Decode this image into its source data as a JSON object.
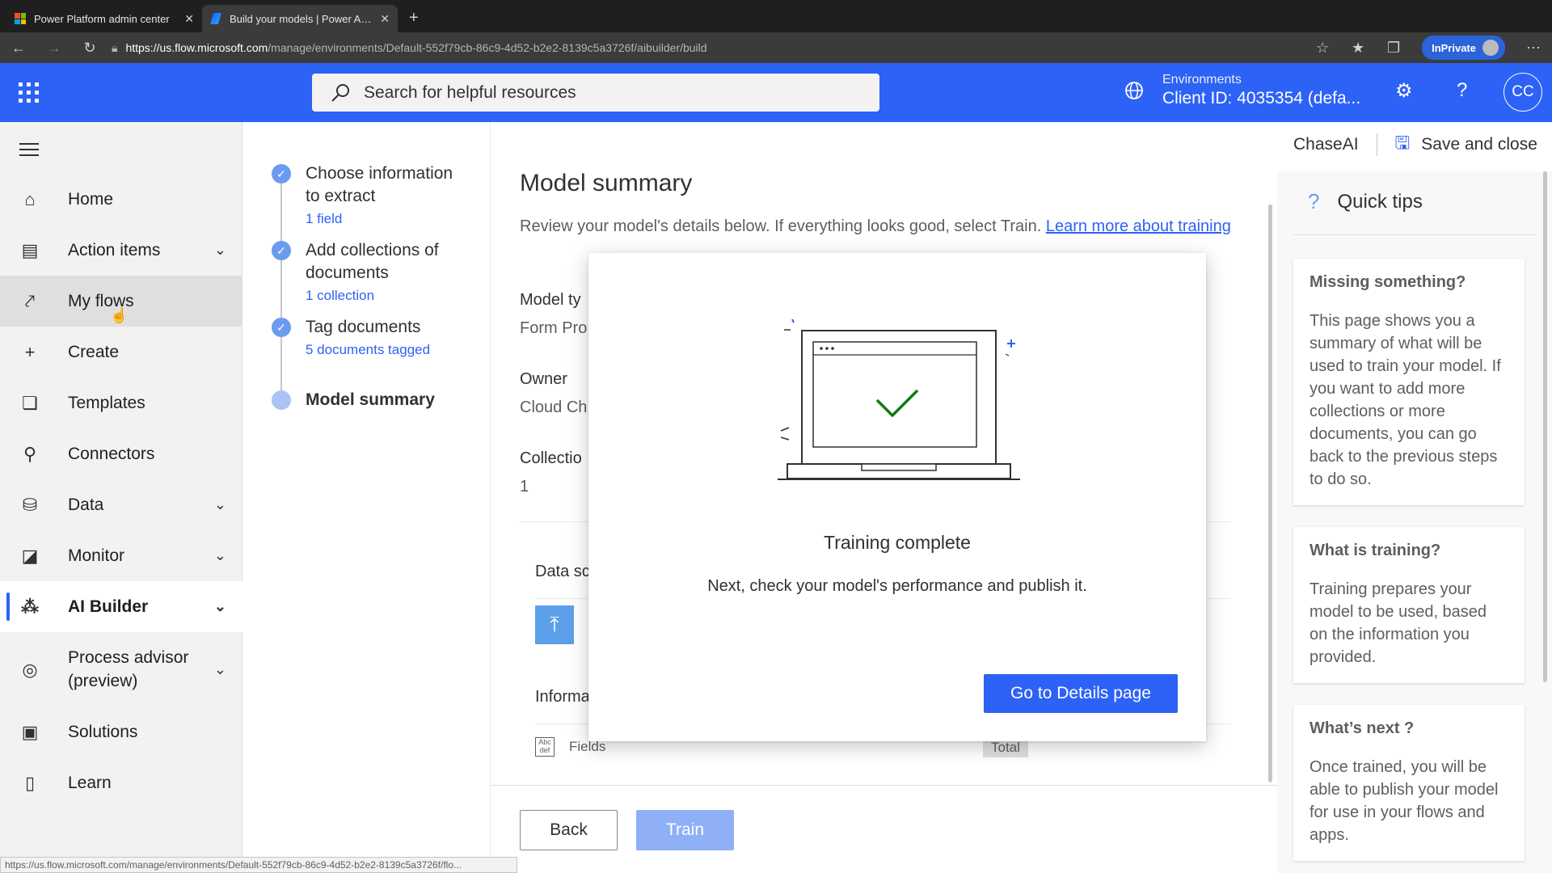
{
  "browser": {
    "tabs": [
      {
        "title": "Power Platform admin center",
        "active": false
      },
      {
        "title": "Build your models | Power Automate",
        "active": true
      }
    ],
    "url_host": "https://us.flow.microsoft.com",
    "url_path": "/manage/environments/Default-552f79cb-86c9-4d52-b2e2-8139c5a3726f/aibuilder/build",
    "inprivate_label": "InPrivate",
    "status_url": "https://us.flow.microsoft.com/manage/environments/Default-552f79cb-86c9-4d52-b2e2-8139c5a3726f/flo..."
  },
  "header": {
    "search_placeholder": "Search for helpful resources",
    "env_label": "Environments",
    "env_value": "Client ID: 4035354 (defa...",
    "avatar_initials": "CC"
  },
  "leftnav": {
    "items": [
      {
        "label": "Home",
        "icon": "home-icon"
      },
      {
        "label": "Action items",
        "icon": "clipboard-icon"
      },
      {
        "label": "My flows",
        "icon": "flow-icon"
      },
      {
        "label": "Create",
        "icon": "plus-icon"
      },
      {
        "label": "Templates",
        "icon": "templates-icon"
      },
      {
        "label": "Connectors",
        "icon": "connector-icon"
      },
      {
        "label": "Data",
        "icon": "database-icon"
      },
      {
        "label": "Monitor",
        "icon": "monitor-icon"
      },
      {
        "label": "AI Builder",
        "icon": "ai-builder-icon"
      },
      {
        "label": "Process advisor (preview)",
        "icon": "process-advisor-icon"
      },
      {
        "label": "Solutions",
        "icon": "solutions-icon"
      },
      {
        "label": "Learn",
        "icon": "learn-icon"
      }
    ]
  },
  "steps": [
    {
      "title": "Choose information to extract",
      "sub": "1 field"
    },
    {
      "title": "Add collections of documents",
      "sub": "1 collection"
    },
    {
      "title": "Tag documents",
      "sub": "5 documents tagged"
    },
    {
      "title": "Model summary",
      "sub": ""
    }
  ],
  "cmdbar": {
    "model_name": "ChaseAI",
    "save_label": "Save and close"
  },
  "main": {
    "title": "Model summary",
    "desc": "Review your model's details below. If everything looks good, select Train.",
    "learn_link": "Learn more about training",
    "model_type_label": "Model ty",
    "model_type_value": "Form Pro",
    "owner_label": "Owner",
    "owner_value": "Cloud Ch",
    "collections_label": "Collectio",
    "collections_value": "1",
    "data_source_label": "Data sc",
    "information_label": "Informa",
    "fields_label": "Fields",
    "total_label": "Total",
    "back_label": "Back",
    "train_label": "Train"
  },
  "tips": {
    "title": "Quick tips",
    "cards": [
      {
        "heading": "Missing something?",
        "body": "This page shows you a summary of what will be used to train your model. If you want to add more collections or more documents, you can go back to the previous steps to do so."
      },
      {
        "heading": "What is training?",
        "body": "Training prepares your model to be used, based on the information you provided."
      },
      {
        "heading": "What’s next ?",
        "body": "Once trained, you will be able to publish your model for use in your flows and apps."
      }
    ]
  },
  "dialog": {
    "title": "Training complete",
    "text": "Next, check your model's performance and publish it.",
    "button_label": "Go to Details page"
  },
  "colors": {
    "brand": "#2d62f6",
    "success": "#107c10"
  }
}
